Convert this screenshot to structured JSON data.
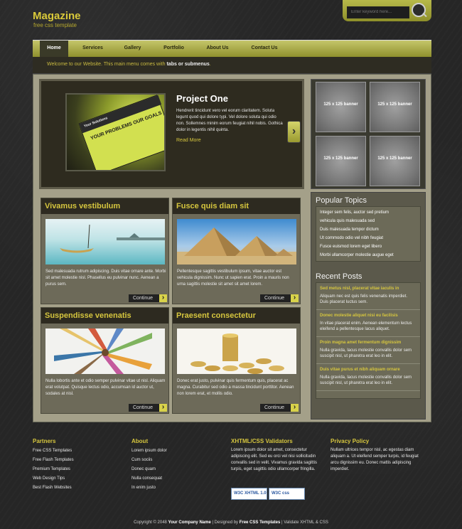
{
  "header": {
    "logo": "Magazine",
    "tagline": "free css template",
    "search_placeholder": "Enter keyword here..."
  },
  "nav": {
    "items": [
      {
        "label": "Home",
        "active": true
      },
      {
        "label": "Services"
      },
      {
        "label": "Gallery"
      },
      {
        "label": "Portfolio"
      },
      {
        "label": "About Us"
      },
      {
        "label": "Contact Us"
      }
    ],
    "welcome_prefix": "Welcome to our Website. This main menu comes with",
    "welcome_strong": "tabs or submenus",
    "welcome_suffix": "."
  },
  "feature": {
    "title": "Project One",
    "body": "Hendrerit tincidunt vero vel eorum claritatem. Soluta legunt quod qui dolore typi. Vel dolore soluta qui odio non. Sollemnes minim eorum feugiat nihil nobis. Gothica dolor in legentis nihil quinta.",
    "read_more": "Read More",
    "image_caption_top": "Your Solutions",
    "image_caption_main": "YOUR PROBLEMS OUR GOALS",
    "next_label": "›"
  },
  "banners": [
    "125 x 125 banner",
    "125 x 125 banner",
    "125 x 125 banner",
    "125 x 125 banner"
  ],
  "posts": [
    {
      "title": "Vivamus vestibulum",
      "text": "Sed malesuada rutrum adipiscing. Duis vitae ornare ante. Morbi sit amet molestie nisl. Phasellus eu pulvinar nunc. Aenean a purus sem.",
      "button": "Continue"
    },
    {
      "title": "Fusce quis diam sit",
      "text": "Pellentesque sagittis vestibulum ipsum, vitae auctor est vehicula dignissim. Nunc ut sapien erat. Proin a mauris non urna sagittis molestie sit amet sit amet lorem.",
      "button": "Continue"
    },
    {
      "title": "Suspendisse venenatis",
      "text": "Nulla lobortis ante et odio semper pulvinar vitae ut nisl. Aliquam erat volutpat. Quisque lectus odio, accumsan id auctor ut, sodales at nisl.",
      "button": "Continue"
    },
    {
      "title": "Praesent consectetur",
      "text": "Donec erat justo, pulvinar quis fermentum quis, placerat ac magna. Curabitur sed odio a massa tincidunt porttitor. Aenean non lorem erat, et mollis odio.",
      "button": "Continue"
    }
  ],
  "sidebar": {
    "popular_title": "Popular Topics",
    "popular": [
      "Integer sem felis, auctor sed pretium",
      "vehicula quis malesuada sed",
      "Duis malesuada tempor dictum",
      "Ut commodo odio vel nibh feugiat",
      "Fusce euismod lorem eget libero",
      "Morbi ullamcorper molestie augue eget"
    ],
    "recent_title": "Recent Posts",
    "recent": [
      {
        "title": "Sed metus nisl, placerat vitae iaculis in",
        "text": "Aliquam nec est quis felis venenatis imperdiet. Duis placerat luctus sem."
      },
      {
        "title": "Donec molestie aliquet nisi eu facilisis",
        "text": "In vitae placerat enim. Aenean elementum lectus eleifend a pellentesque lacus aliquet."
      },
      {
        "title": "Proin magna amet fermentum dignissim",
        "text": "Nulla gravida, lacus molestie convallis dolor sem suscipit nisl, ut pharetra erat leo in elit."
      },
      {
        "title": "Duis vitae purus et nibh aliquam ornare",
        "text": "Nulla gravida, lacus molestie convallis dolor sem suscipit nisl, ut pharetra erat leo in elit."
      }
    ]
  },
  "footer": {
    "partners_title": "Partners",
    "partners": [
      "Free CSS Templates",
      "Free Flash Templates",
      "Premium Templates",
      "Web Design Tips",
      "Best Flash Websites"
    ],
    "about_title": "About",
    "about": [
      "Lorem ipsum dolor",
      "Cum sociis",
      "Donec quam",
      "Nulla consequat",
      "In enim justo"
    ],
    "validators_title": "XHTML/CSS Validators",
    "validators_text": "Lorem ipsum dolor sit amet, consectetur adipiscing elit. Sed eu orci vel nisi sollicitudin convallis sed in velit. Vivamus gravida sagittis turpis, eget sagittis odio ullamcorper fringilla.",
    "badge_xhtml": "W3C XHTML 1.0",
    "badge_css": "W3C css",
    "privacy_title": "Privacy Policy",
    "privacy_text": "Nullam ultrices tempor nisl, ac egestas diam aliquam a. Ut eleifend semper turpis, id feugiat arcu dignissim eu. Donec mattis adipiscing imperdiet.",
    "copyright_prefix": "Copyright © 2048",
    "company": "Your Company Name",
    "designed_by_label": "| Designed by",
    "designer": "Free CSS Templates",
    "validate_label": "| Validate XHTML & CSS"
  }
}
